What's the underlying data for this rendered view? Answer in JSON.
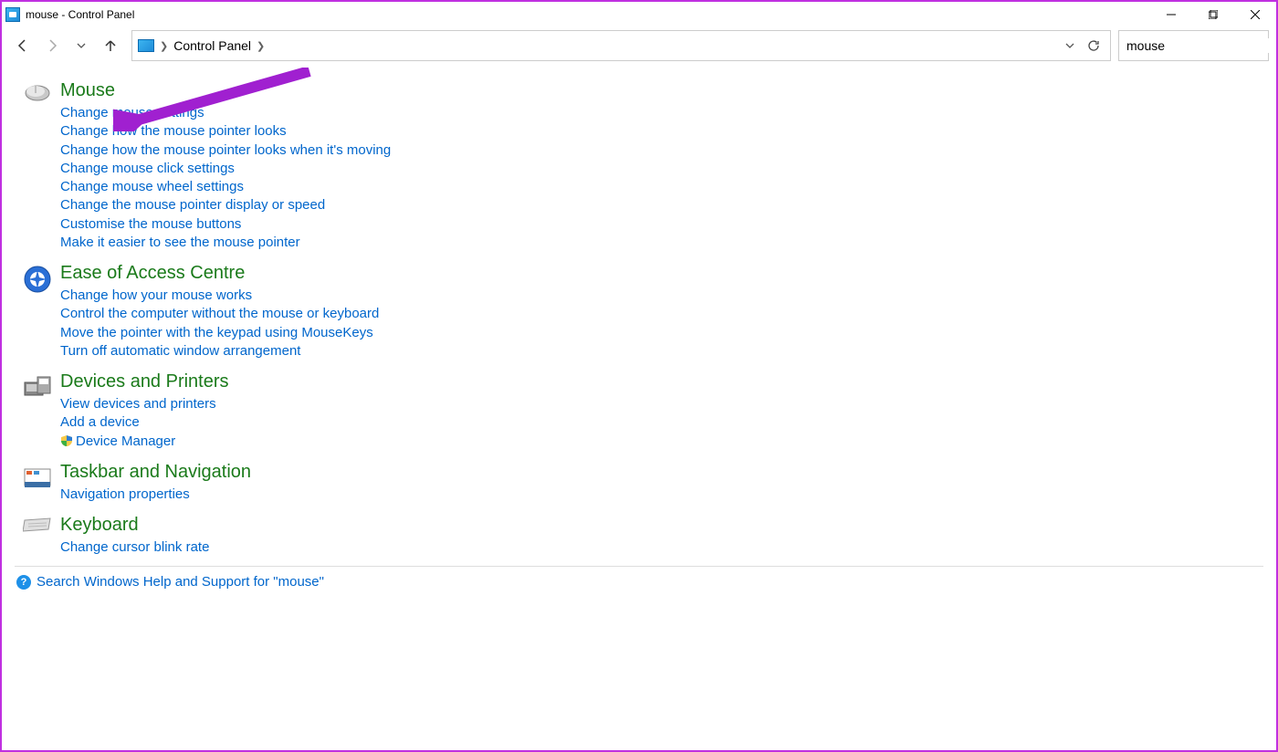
{
  "window": {
    "title": "mouse - Control Panel"
  },
  "breadcrumb": {
    "item": "Control Panel"
  },
  "search": {
    "value": "mouse"
  },
  "categories": [
    {
      "title": "Mouse",
      "icon": "mouse",
      "links": [
        "Change mouse settings",
        "Change how the mouse pointer looks",
        "Change how the mouse pointer looks when it's moving",
        "Change mouse click settings",
        "Change mouse wheel settings",
        "Change the mouse pointer display or speed",
        "Customise the mouse buttons",
        "Make it easier to see the mouse pointer"
      ]
    },
    {
      "title": "Ease of Access Centre",
      "icon": "ease",
      "links": [
        "Change how your mouse works",
        "Control the computer without the mouse or keyboard",
        "Move the pointer with the keypad using MouseKeys",
        "Turn off automatic window arrangement"
      ]
    },
    {
      "title": "Devices and Printers",
      "icon": "devices",
      "links": [
        "View devices and printers",
        "Add a device",
        "Device Manager"
      ],
      "shield_index": 2
    },
    {
      "title": "Taskbar and Navigation",
      "icon": "taskbar",
      "links": [
        "Navigation properties"
      ]
    },
    {
      "title": "Keyboard",
      "icon": "keyboard",
      "links": [
        "Change cursor blink rate"
      ]
    }
  ],
  "help": {
    "text": "Search Windows Help and Support for \"mouse\""
  }
}
